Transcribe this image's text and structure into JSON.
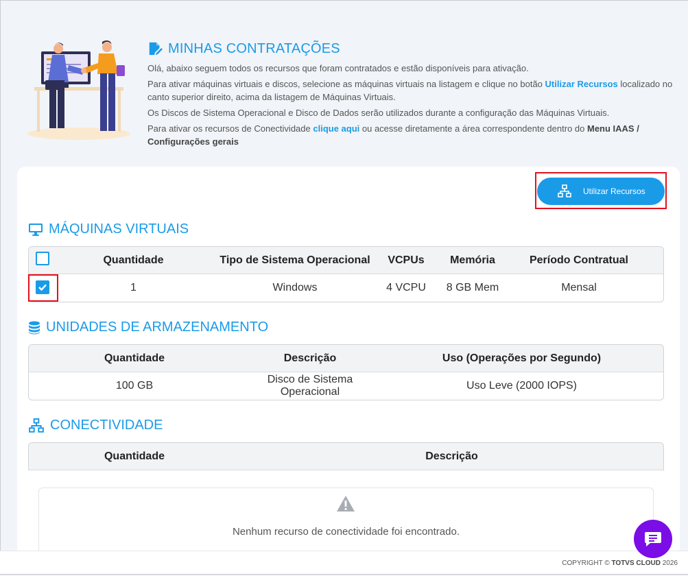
{
  "intro": {
    "title": "MINHAS CONTRATAÇÕES",
    "p1": "Olá, abaixo seguem todos os recursos que foram contratados e estão disponíveis para ativação.",
    "p2_a": "Para ativar máquinas virtuais e discos, selecione as máquinas virtuais na listagem e clique no botão ",
    "p2_link": "Utilizar Recursos",
    "p2_b": " localizado no canto superior direito, acima da listagem de Máquinas Virtuais.",
    "p3": "Os Discos de Sistema Operacional e Disco de Dados serão utilizados durante a configuração das Máquinas Virtuais.",
    "p4_a": "Para ativar os recursos de Conectividade ",
    "p4_link": "clique aqui",
    "p4_b": " ou acesse diretamente a área correspondente dentro do ",
    "p4_bold": "Menu IAAS / Configurações gerais"
  },
  "actions": {
    "use_resources": "Utilizar Recursos"
  },
  "vms": {
    "title": "MÁQUINAS VIRTUAIS",
    "headers": [
      "Quantidade",
      "Tipo de Sistema Operacional",
      "VCPUs",
      "Memória",
      "Período Contratual"
    ],
    "rows": [
      {
        "checked": true,
        "cells": [
          "1",
          "Windows",
          "4 VCPU",
          "8 GB Mem",
          "Mensal"
        ]
      }
    ]
  },
  "storage": {
    "title": "UNIDADES DE ARMAZENAMENTO",
    "headers": [
      "Quantidade",
      "Descrição",
      "Uso (Operações por Segundo)"
    ],
    "rows": [
      {
        "cells": [
          "100 GB",
          "Disco de Sistema Operacional",
          "Uso Leve (2000 IOPS)"
        ]
      }
    ]
  },
  "connectivity": {
    "title": "CONECTIVIDADE",
    "headers": [
      "Quantidade",
      "Descrição"
    ],
    "empty_message": "Nenhum recurso de conectividade foi encontrado."
  },
  "footer": {
    "prefix": "COPYRIGHT ©",
    "brand": "TOTVS CLOUD",
    "year": "2026"
  },
  "colors": {
    "accent": "#1a9be8",
    "highlight": "#e3101d",
    "chat": "#7b0de6"
  },
  "icons": [
    "edit-document-icon",
    "network-icon",
    "monitor-icon",
    "database-icon",
    "warning-icon",
    "chat-icon",
    "checkmark-icon"
  ]
}
